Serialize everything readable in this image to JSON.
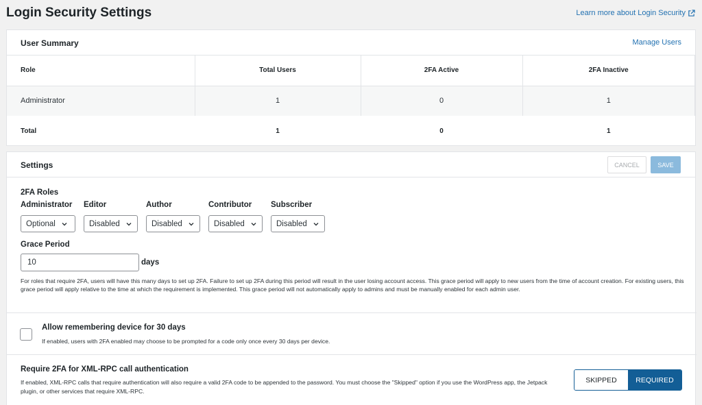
{
  "header": {
    "title": "Login Security Settings",
    "learn_more": "Learn more about Login Security"
  },
  "summary": {
    "title": "User Summary",
    "manage_users": "Manage Users",
    "columns": [
      "Role",
      "Total Users",
      "2FA Active",
      "2FA Inactive"
    ],
    "rows": [
      {
        "role": "Administrator",
        "total": "1",
        "active": "0",
        "inactive": "1"
      }
    ],
    "total_row": {
      "label": "Total",
      "total": "1",
      "active": "0",
      "inactive": "1"
    }
  },
  "settings": {
    "title": "Settings",
    "cancel_label": "CANCEL",
    "save_label": "SAVE",
    "roles": {
      "title": "2FA Roles",
      "items": [
        {
          "label": "Administrator",
          "value": "Optional"
        },
        {
          "label": "Editor",
          "value": "Disabled"
        },
        {
          "label": "Author",
          "value": "Disabled"
        },
        {
          "label": "Contributor",
          "value": "Disabled"
        },
        {
          "label": "Subscriber",
          "value": "Disabled"
        }
      ]
    },
    "grace": {
      "title": "Grace Period",
      "value": "10",
      "unit": "days",
      "help": "For roles that require 2FA, users will have this many days to set up 2FA. Failure to set up 2FA during this period will result in the user losing account access. This grace period will apply to new users from the time of account creation. For existing users, this grace period will apply relative to the time at which the requirement is implemented. This grace period will not automatically apply to admins and must be manually enabled for each admin user."
    },
    "remember": {
      "title": "Allow remembering device for 30 days",
      "help": "If enabled, users with 2FA enabled may choose to be prompted for a code only once every 30 days per device.",
      "checked": false
    },
    "xmlrpc": {
      "title": "Require 2FA for XML-RPC call authentication",
      "help": "If enabled, XML-RPC calls that require authentication will also require a valid 2FA code to be appended to the password. You must choose the \"Skipped\" option if you use the WordPress app, the Jetpack plugin, or other services that require XML-RPC.",
      "options": [
        "SKIPPED",
        "REQUIRED"
      ],
      "selected": "REQUIRED"
    }
  },
  "colors": {
    "accent": "#135e96",
    "link": "#2271b1",
    "save_disabled": "#8bbadd"
  }
}
